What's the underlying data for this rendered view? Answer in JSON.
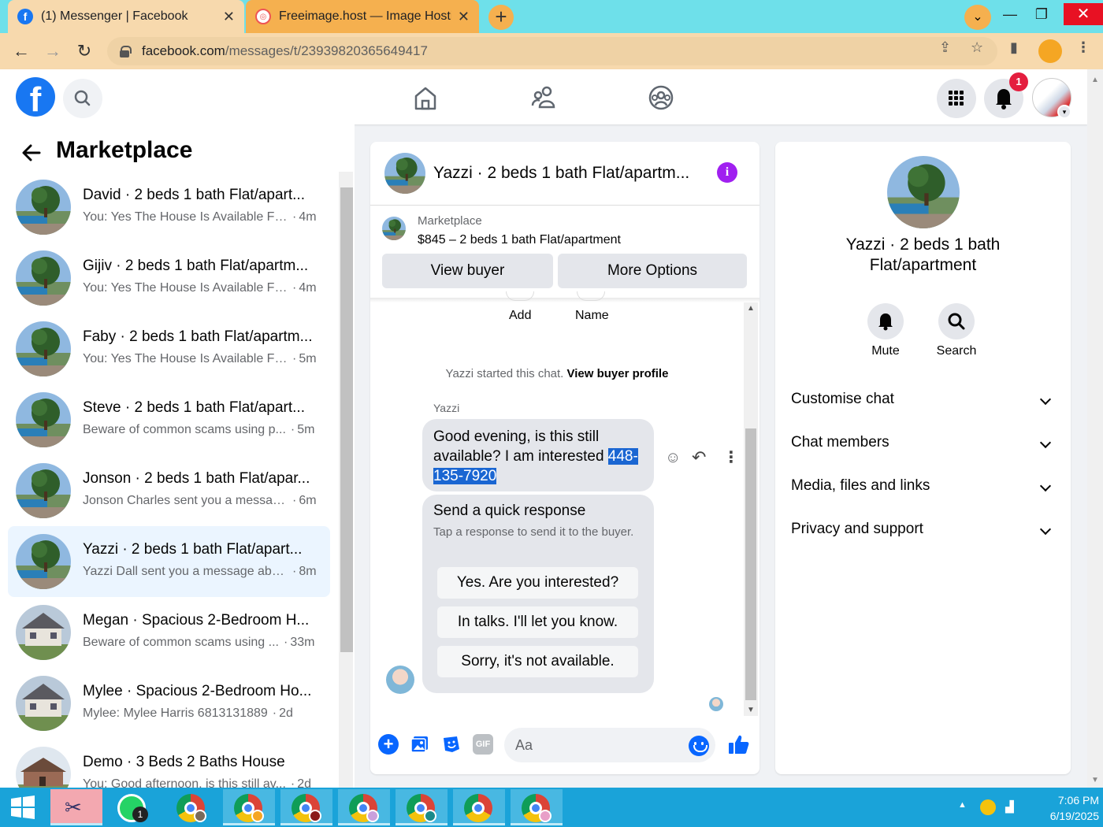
{
  "browser": {
    "tabs": [
      {
        "title": "(1) Messenger | Facebook",
        "favicon": "facebook-icon",
        "active": true
      },
      {
        "title": "Freeimage.host — Image Hosting",
        "favicon": "freeimage-icon",
        "active": false
      }
    ],
    "url_domain": "facebook.com",
    "url_path": "/messages/t/23939820365649417"
  },
  "fb_header": {
    "logo": "f",
    "notification_badge": "1"
  },
  "left_panel": {
    "title": "Marketplace",
    "conversations": [
      {
        "name": "David · 2 beds 1 bath Flat/apart...",
        "snippet": "You: Yes The House Is Available Fo...",
        "time": "4m",
        "avatar": "tree",
        "active": false
      },
      {
        "name": "Gijiv · 2 beds 1 bath Flat/apartm...",
        "snippet": "You: Yes The House Is Available Fo...",
        "time": "4m",
        "avatar": "tree",
        "active": false
      },
      {
        "name": "Faby · 2 beds 1 bath Flat/apartm...",
        "snippet": "You: Yes The House Is Available Fo...",
        "time": "5m",
        "avatar": "tree",
        "active": false
      },
      {
        "name": "Steve · 2 beds 1 bath Flat/apart...",
        "snippet": "Beware of common scams using p...",
        "time": "5m",
        "avatar": "tree",
        "active": false
      },
      {
        "name": "Jonson · 2 beds 1 bath Flat/apar...",
        "snippet": "Jonson Charles sent you a messag...",
        "time": "6m",
        "avatar": "tree",
        "active": false
      },
      {
        "name": "Yazzi · 2 beds 1 bath Flat/apart...",
        "snippet": "Yazzi Dall sent you a message abo...",
        "time": "8m",
        "avatar": "tree",
        "active": true
      },
      {
        "name": "Megan · Spacious 2-Bedroom H...",
        "snippet": "Beware of common scams using ...",
        "time": "33m",
        "avatar": "house",
        "active": false
      },
      {
        "name": "Mylee · Spacious 2-Bedroom Ho...",
        "snippet": "Mylee: Mylee Harris 6813131889",
        "time": "2d",
        "avatar": "house",
        "active": false
      },
      {
        "name": "Demo · 3 Beds 2 Baths House",
        "snippet": "You: Good afternoon, is this still av...",
        "time": "2d",
        "avatar": "house2",
        "active": false
      }
    ]
  },
  "conversation": {
    "title": "Yazzi · 2 beds 1 bath Flat/apartm...",
    "marketplace_label": "Marketplace",
    "listing": "$845 – 2 beds 1 bath Flat/apartment",
    "view_buyer": "View buyer",
    "more_options": "More Options",
    "add_label": "Add",
    "name_label": "Name",
    "started_prefix": "Yazzi started this chat.",
    "started_link": "View buyer profile",
    "sender": "Yazzi",
    "message_text": "Good evening, is this still available? I am interested ",
    "message_highlight": "448-135-7920",
    "quick_title": "Send a quick response",
    "quick_sub": "Tap a response to send it to the buyer.",
    "quick_replies": [
      "Yes. Are you interested?",
      "In talks. I'll let you know.",
      "Sorry, it's not available."
    ],
    "input_placeholder": "Aa",
    "gif_label": "GIF"
  },
  "right_panel": {
    "name": "Yazzi · 2 beds 1 bath Flat/apartment",
    "mute_label": "Mute",
    "search_label": "Search",
    "rows": [
      "Customise chat",
      "Chat members",
      "Media, files and links",
      "Privacy and support"
    ]
  },
  "taskbar": {
    "time": "7:06 PM",
    "date": "6/19/2025",
    "whatsapp_badge": "1"
  },
  "colors": {
    "tab_bar": "#6ee0ea",
    "active_tab": "#f7d9ad",
    "fb_blue": "#1877f2",
    "active_conv": "#ebf5ff",
    "highlight": "#1a66d2",
    "taskbar": "#1aa3d9"
  }
}
